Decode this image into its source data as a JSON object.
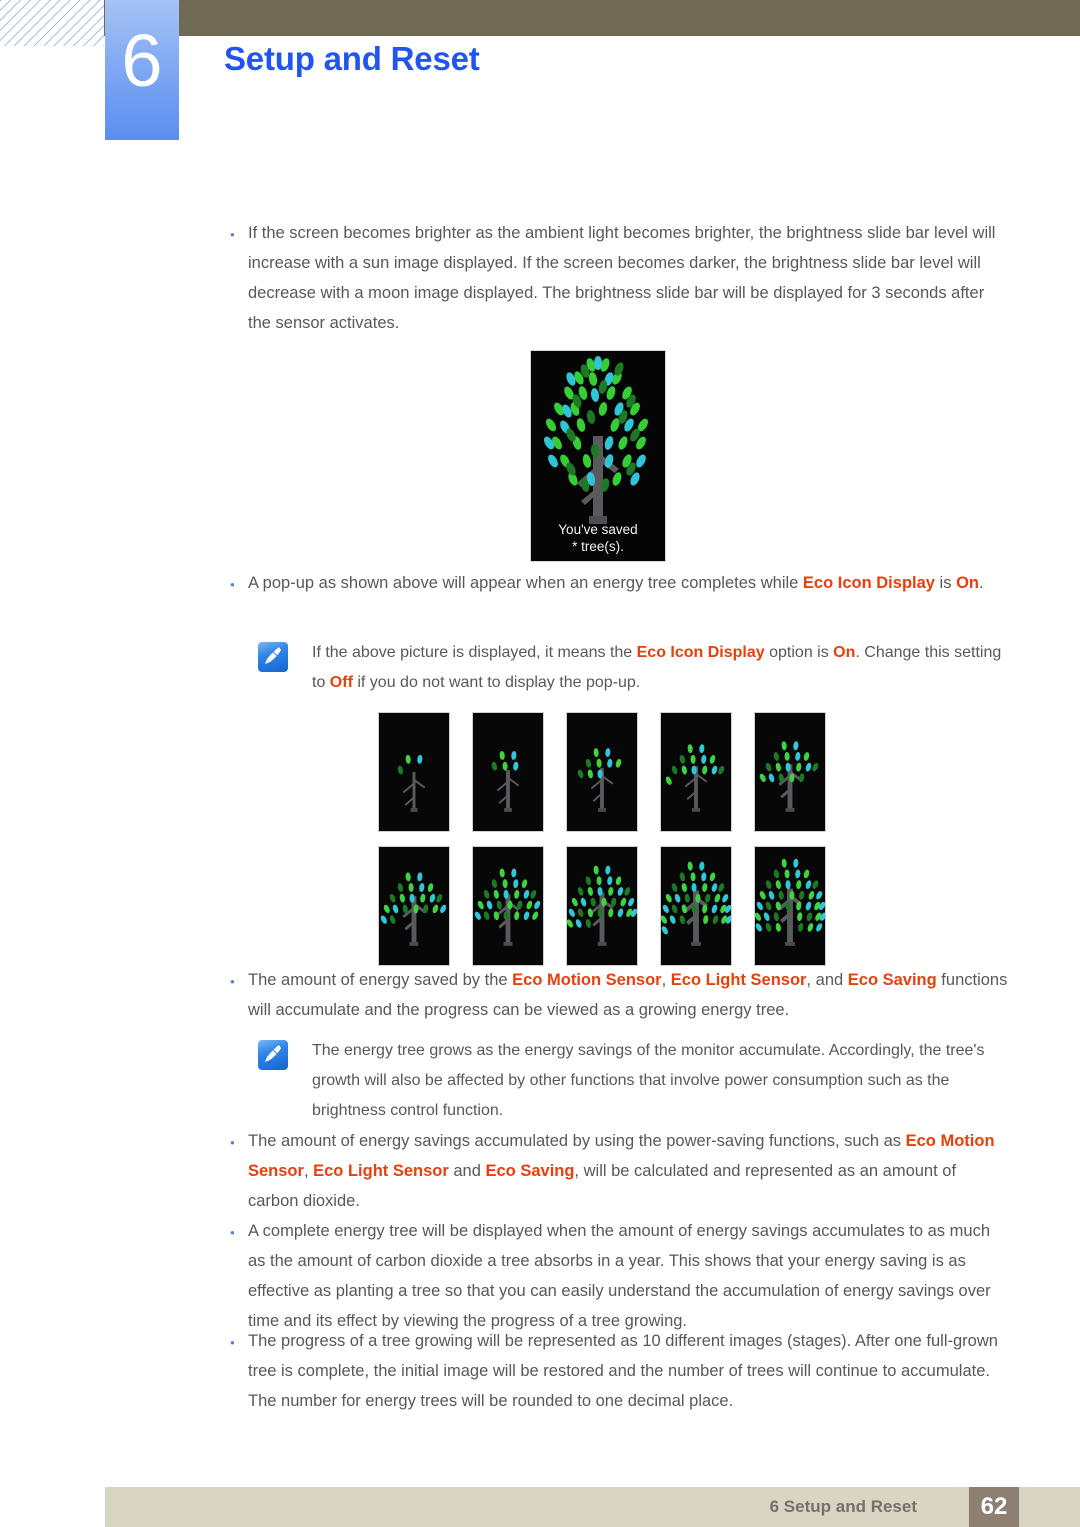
{
  "header": {
    "chapter_number": "6",
    "chapter_title": "Setup and Reset"
  },
  "body": {
    "bullet1": "If the screen becomes brighter as the ambient light becomes brighter, the brightness slide bar level will increase with a sun image displayed. If the screen becomes darker, the brightness slide bar level will decrease with a moon image displayed. The brightness slide bar will be displayed for 3 seconds after the sensor activates.",
    "bullet2_pre": "A pop-up as shown above will appear when an energy tree completes while ",
    "bullet2_hl1": "Eco Icon Display",
    "bullet2_mid": " is ",
    "bullet2_hl2": "On",
    "bullet2_post": ".",
    "note1_pre": "If the above picture is displayed, it means the ",
    "note1_hl1": "Eco Icon Display",
    "note1_mid1": " option is ",
    "note1_hl2": "On",
    "note1_mid2": ". Change this setting to ",
    "note1_hl3": "Off",
    "note1_post": " if you do not want to display the pop-up.",
    "bullet3_pre": "The amount of energy saved by the ",
    "bullet3_hl1": "Eco Motion Sensor",
    "bullet3_mid1": ", ",
    "bullet3_hl2": "Eco Light Sensor",
    "bullet3_mid2": ", and ",
    "bullet3_hl3": "Eco Saving",
    "bullet3_post": " functions will accumulate and the progress can be viewed as a growing energy tree.",
    "note2": "The energy tree grows as the energy savings of the monitor accumulate. Accordingly, the tree's growth will also be affected by other functions that involve power consumption such as the brightness control function.",
    "bullet4_pre": "The amount of energy savings accumulated by using the power-saving functions, such as ",
    "bullet4_hl1": "Eco Motion Sensor",
    "bullet4_mid1": ", ",
    "bullet4_hl2": "Eco Light Sensor",
    "bullet4_mid2": " and ",
    "bullet4_hl3": "Eco Saving",
    "bullet4_post": ", will be calculated and represented as an amount of carbon dioxide.",
    "bullet5": "A complete energy tree will be displayed when the amount of energy savings accumulates to as much as the amount of carbon dioxide a tree absorbs in a year. This shows that your energy saving is as effective as planting a tree so that you can easily understand the accumulation of energy savings over time and its effect by viewing the progress of a tree growing.",
    "bullet6": "The progress of a tree growing will be represented as 10 different images (stages). After one full-grown tree is complete, the initial image will be restored and the number of trees will continue to accumulate. The number for energy trees will be rounded to one decimal place."
  },
  "popup": {
    "caption_line1": "You've saved",
    "caption_line2": "* tree(s)."
  },
  "tree_stages": {
    "count": 10,
    "labels": [
      "stage-1",
      "stage-2",
      "stage-3",
      "stage-4",
      "stage-5",
      "stage-6",
      "stage-7",
      "stage-8",
      "stage-9",
      "stage-10"
    ]
  },
  "footer": {
    "text": "6 Setup and Reset",
    "page_number": "62"
  },
  "colors": {
    "header_bar": "#6e6a53",
    "chapter_tab": "#82aaf4",
    "title_blue": "#2255ef",
    "highlight_orange": "#e8400c",
    "body_gray": "#58585a",
    "footer_bar": "#d9d5c3",
    "page_box": "#8d8073",
    "leaf_green": "#3fd43f",
    "leaf_cyan": "#2fc8d8",
    "trunk_gray": "#5a5a5e"
  }
}
